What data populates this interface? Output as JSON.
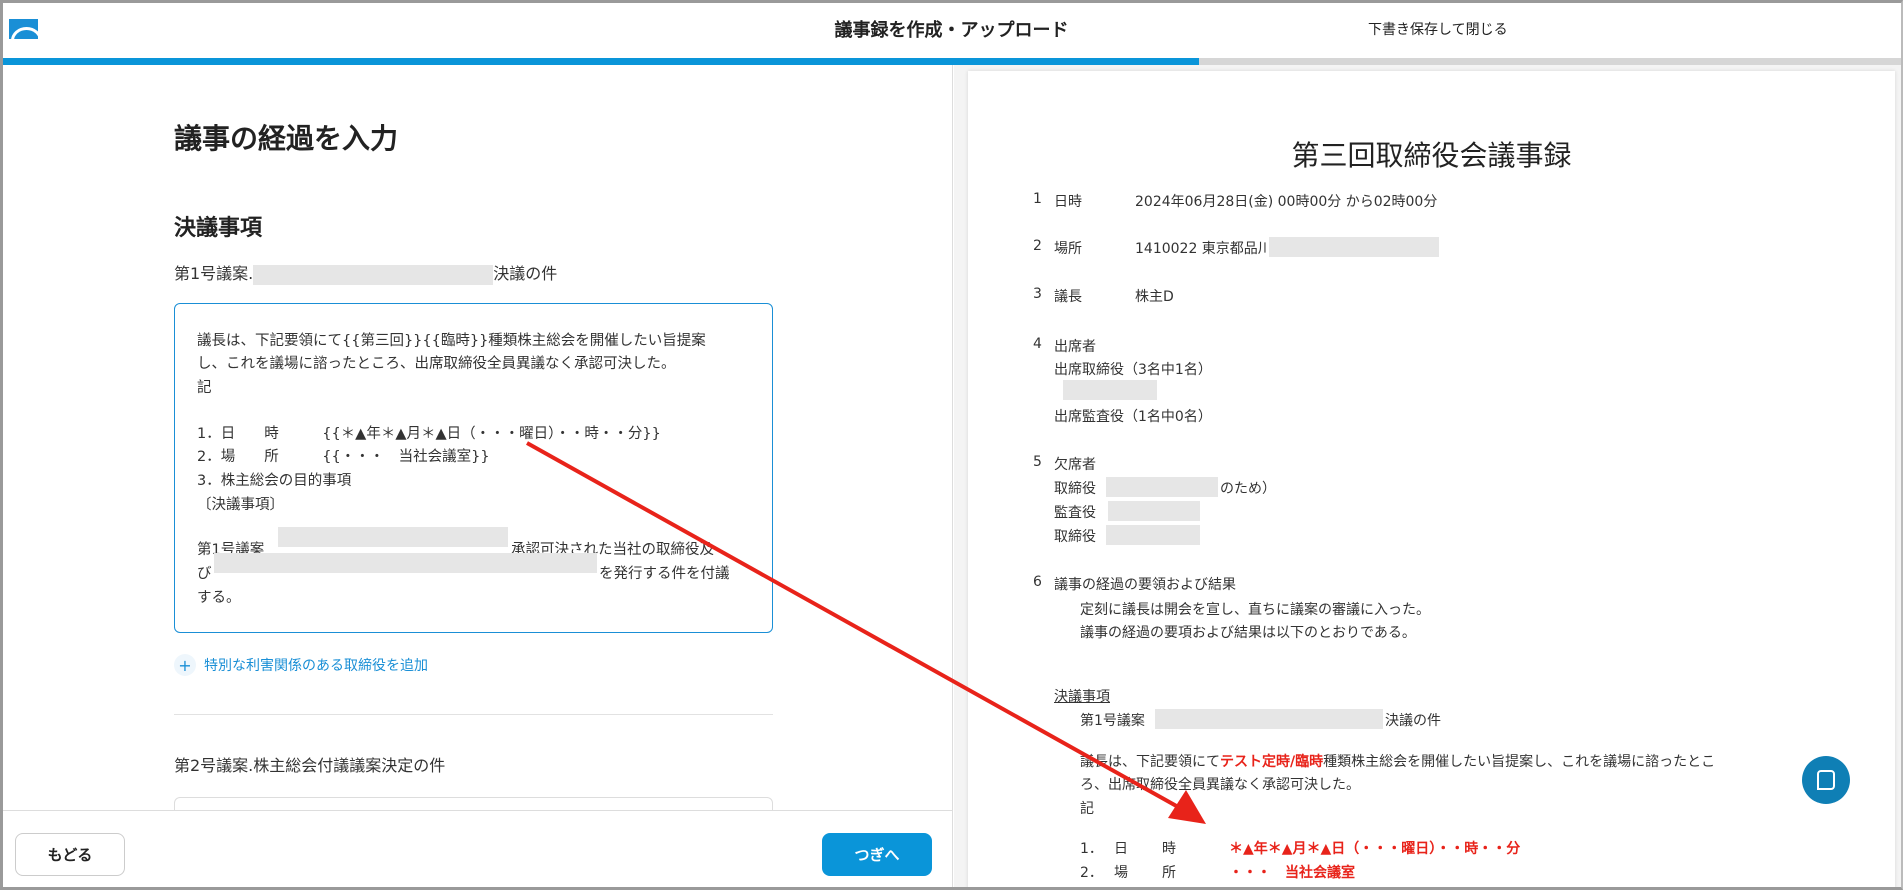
{
  "header": {
    "title": "議事録を作成・アップロード",
    "save_close": "下書き保存して閉じる",
    "progress_percent": 63
  },
  "colors": {
    "accent": "#0a95d9",
    "highlight": "#e8231a",
    "annotation_arrow": "#e8231a"
  },
  "left": {
    "page_title": "議事の経過を入力",
    "section_title": "決議事項",
    "item1": {
      "label_prefix": "第1号議案.",
      "label_suffix": "決議の件",
      "textarea_lines": [
        "議長は、下記要領にて{{第三回}}{{臨時}}種類株主総会を開催したい旨提案",
        "し、これを議場に諮ったところ、出席取締役全員異議なく承認可決した。",
        "記",
        "1．日　　時　　　{{＊▲年＊▲月＊▲日（・・・曜日）・・時・・分}}",
        "2．場　　所　　　{{・・・　当社会議室}}",
        "3．株主総会の目的事項",
        "〔決議事項〕",
        "第1号議案",
        "承認可決された当社の取締役及",
        "び",
        "を発行する件を付議",
        "する。"
      ]
    },
    "add_link": "特別な利害関係のある取締役を追加",
    "item2_label": "第2号議案.株主総会付議議案決定の件",
    "back_button": "もどる",
    "next_button": "つぎへ"
  },
  "preview": {
    "title": "第三回取締役会議事録",
    "items": [
      {
        "num": "1",
        "label": "日時",
        "value": "2024年06月28日(金) 00時00分 から02時00分"
      },
      {
        "num": "2",
        "label": "場所",
        "value": "1410022 東京都品川区"
      },
      {
        "num": "3",
        "label": "議長",
        "value": "株主D"
      },
      {
        "num": "4",
        "label": "出席者"
      },
      {
        "num": "5",
        "label": "欠席者"
      },
      {
        "num": "6",
        "label": "議事の経過の要領および結果"
      }
    ],
    "attend_directors": "出席取締役（3名中1名）",
    "attend_auditors": "出席監査役（1名中0名）",
    "absent": [
      "取締役",
      "のため）",
      "監査役",
      "取締役"
    ],
    "proceedings": [
      "定刻に議長は開会を宣し、直ちに議案の審議に入った。",
      "議事の経過の要項および結果は以下のとおりである。"
    ],
    "resolutions_heading": "決議事項",
    "res1_prefix": "第1号議案",
    "res1_suffix": "決議の件",
    "para_a": "議長は、下記要領にて",
    "para_red": "テスト定時/臨時",
    "para_b": "種類株主総会を開催したい旨提案し、これを議場に諮ったとこ",
    "para_c": "ろ、出席取締役全員異議なく承認可決した。",
    "ki": "記",
    "row1": {
      "n": "1．",
      "a": "日",
      "b": "時",
      "value": "＊▲年＊▲月＊▲日（・・・曜日）・・時・・分"
    },
    "row2": {
      "n": "2．",
      "a": "場",
      "b": "所",
      "value": "・・・　当社会議室"
    }
  },
  "chat_icon": "chat-bubble-icon"
}
